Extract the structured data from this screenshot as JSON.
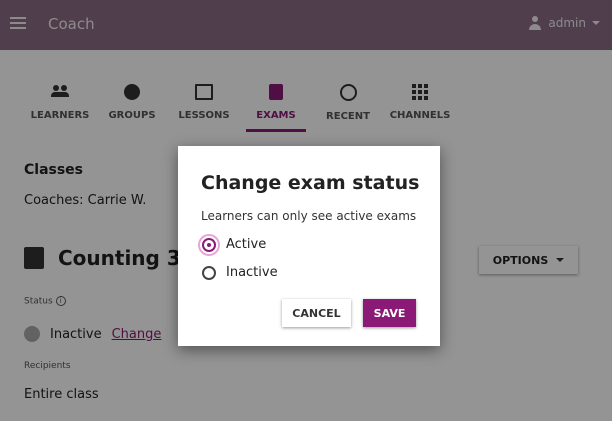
{
  "appbar": {
    "title": "Coach",
    "user": "admin"
  },
  "tabs": [
    {
      "label": "LEARNERS",
      "icon": "people-icon"
    },
    {
      "label": "GROUPS",
      "icon": "groups-icon"
    },
    {
      "label": "LESSONS",
      "icon": "book-icon"
    },
    {
      "label": "EXAMS",
      "icon": "clipboard-icon",
      "active": true
    },
    {
      "label": "RECENT",
      "icon": "clock-icon"
    },
    {
      "label": "CHANNELS",
      "icon": "grid-icon"
    }
  ],
  "classes": {
    "heading": "Classes",
    "coaches": "Coaches: Carrie W."
  },
  "exam": {
    "title": "Counting 3",
    "options_label": "OPTIONS",
    "status_label": "Status",
    "status_value": "Inactive",
    "change_link": "Change",
    "recipients_label": "Recipients",
    "recipients_value": "Entire class"
  },
  "modal": {
    "title": "Change exam status",
    "description": "Learners can only see active exams",
    "options": [
      {
        "label": "Active",
        "selected": true
      },
      {
        "label": "Inactive",
        "selected": false
      }
    ],
    "cancel_label": "CANCEL",
    "save_label": "SAVE"
  },
  "colors": {
    "appbar": "#8a6b84",
    "accent": "#8a1a75"
  }
}
